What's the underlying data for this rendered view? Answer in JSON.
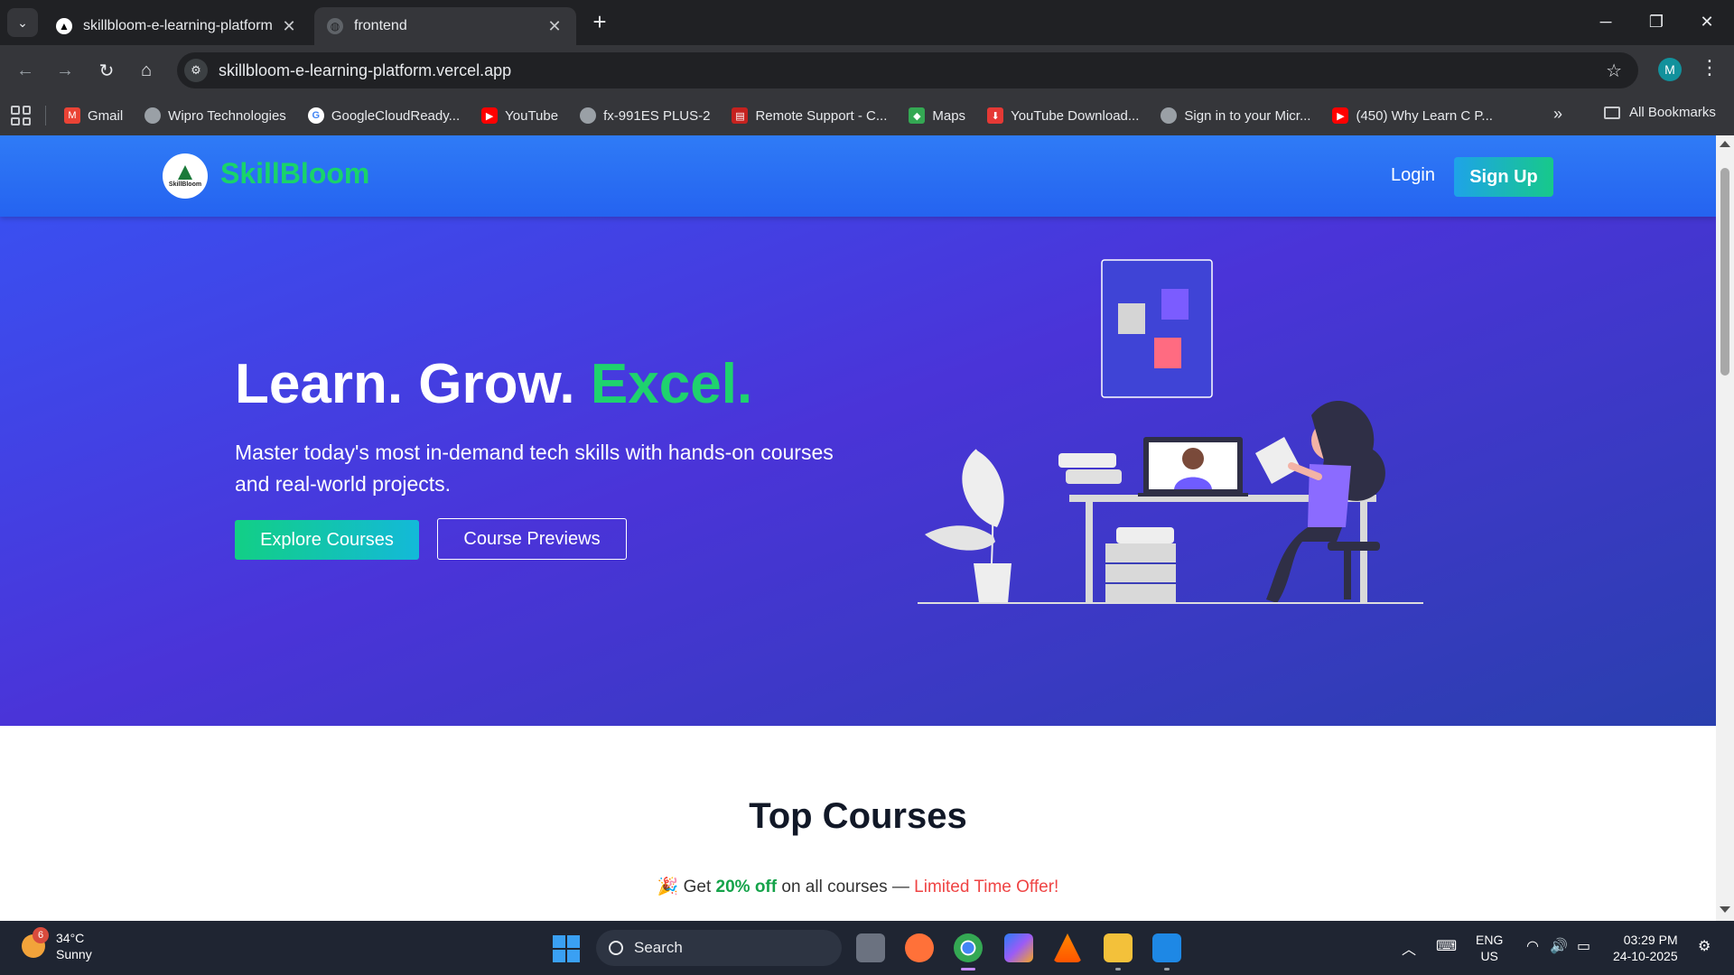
{
  "browser": {
    "tabs": [
      {
        "title": "skillbloom-e-learning-platform",
        "active": false
      },
      {
        "title": "frontend",
        "active": true
      }
    ],
    "url": "skillbloom-e-learning-platform.vercel.app",
    "profile_initial": "M"
  },
  "bookmarks": {
    "items": [
      {
        "label": "Gmail",
        "icon": "gmail-icon"
      },
      {
        "label": "Wipro Technologies",
        "icon": "globe-icon"
      },
      {
        "label": "GoogleCloudReady...",
        "icon": "google-icon"
      },
      {
        "label": "YouTube",
        "icon": "youtube-icon"
      },
      {
        "label": "fx-991ES PLUS-2",
        "icon": "globe-icon"
      },
      {
        "label": "Remote Support - C...",
        "icon": "remote-support-icon"
      },
      {
        "label": "Maps",
        "icon": "maps-icon"
      },
      {
        "label": "YouTube Download...",
        "icon": "download-icon"
      },
      {
        "label": "Sign in to your Micr...",
        "icon": "globe-icon"
      },
      {
        "label": "(450) Why Learn C P...",
        "icon": "youtube-icon"
      }
    ],
    "all_label": "All Bookmarks"
  },
  "site": {
    "brand": "SkillBloom",
    "logo_text": "SkillBloom",
    "nav": {
      "login": "Login",
      "signup": "Sign Up"
    },
    "hero": {
      "title_part1": "Learn. Grow. ",
      "title_accent": "Excel.",
      "subtitle": "Master today's most in-demand tech skills with hands-on courses and real-world projects.",
      "explore_btn": "Explore Courses",
      "preview_btn": "Course Previews"
    },
    "courses": {
      "title": "Top Courses",
      "offer_emoji": "🎉",
      "offer_pre": "Get ",
      "offer_pct": "20% off",
      "offer_mid": " on all courses — ",
      "offer_ltd": "Limited Time Offer!"
    },
    "colors": {
      "accent_green": "#1fd26e",
      "header_blue": "#2f7bf6",
      "hero_purple": "#4a34d8",
      "offer_red": "#ef4444"
    }
  },
  "taskbar": {
    "weather": {
      "temp": "34°C",
      "condition": "Sunny",
      "badge": "6"
    },
    "search_label": "Search",
    "lang": {
      "line1": "ENG",
      "line2": "US"
    },
    "time": "03:29 PM",
    "date": "24-10-2025"
  }
}
